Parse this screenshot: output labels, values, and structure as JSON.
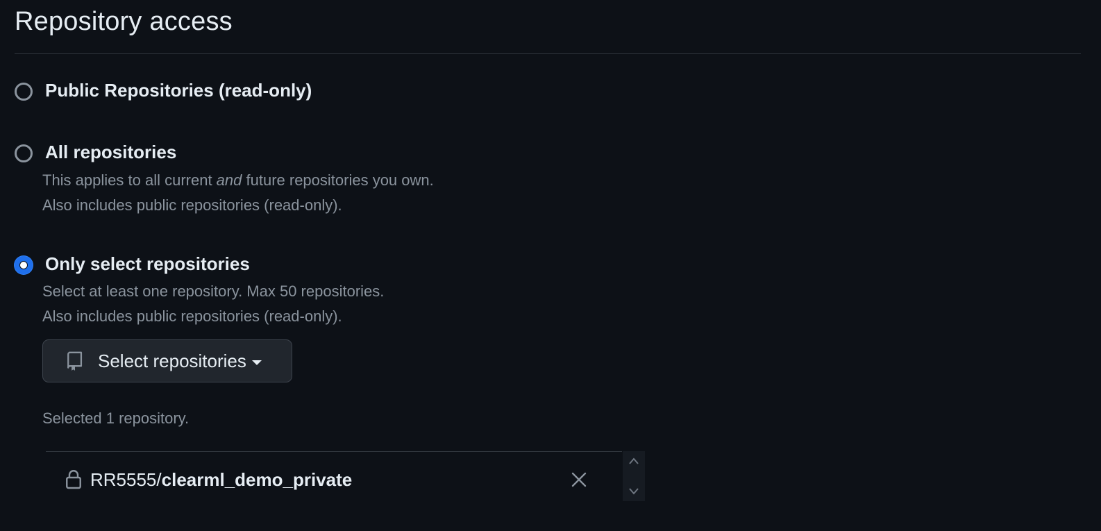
{
  "section": {
    "title": "Repository access"
  },
  "options": {
    "public": {
      "label": "Public Repositories (read-only)",
      "selected": false
    },
    "all": {
      "label": "All repositories",
      "desc1_pre": "This applies to all current ",
      "desc1_em": "and",
      "desc1_post": " future repositories you own.",
      "desc2": "Also includes public repositories (read-only).",
      "selected": false
    },
    "select": {
      "label": "Only select repositories",
      "desc1": "Select at least one repository. Max 50 repositories.",
      "desc2": "Also includes public repositories (read-only).",
      "selected": true
    }
  },
  "select_button": {
    "label": "Select repositories",
    "icon": "repo-icon"
  },
  "selection": {
    "summary": "Selected 1 repository.",
    "repos": [
      {
        "owner": "RR5555",
        "separator": "/",
        "name": "clearml_demo_private",
        "icon": "lock-icon"
      }
    ]
  },
  "colors": {
    "background": "#0d1117",
    "accent": "#1f6feb",
    "muted_text": "#8b949e",
    "border": "#30363d"
  }
}
